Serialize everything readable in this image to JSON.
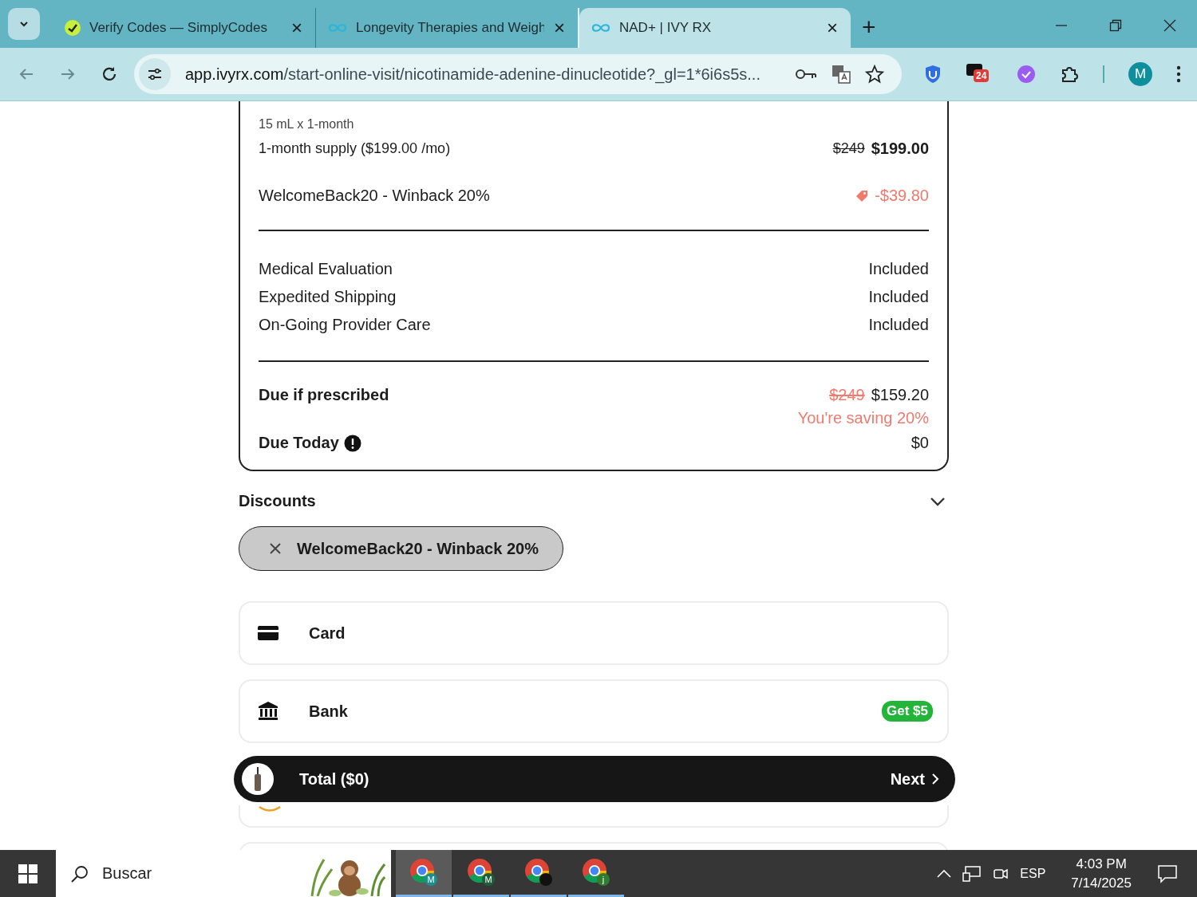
{
  "browser": {
    "tabs": [
      {
        "title": "Verify Codes — SimplyCodes",
        "close": "×",
        "selected": false,
        "kind": "simplycodes"
      },
      {
        "title": "Longevity Therapies and Weigh",
        "close": "×",
        "selected": false,
        "kind": "ivy"
      },
      {
        "title": "NAD+ | IVY RX",
        "close": "×",
        "selected": true,
        "kind": "ivy"
      }
    ],
    "new_tab": "+",
    "url_host": "app.ivyrx.com",
    "url_path": "/start-online-visit/nicotinamide-adenine-dinucleotide?_gl=1*6i6s5s...",
    "notification_badge": "24",
    "profile": "M"
  },
  "order": {
    "variant": "15 mL x 1-month",
    "supply": {
      "label": "1-month supply ($199.00 /mo)",
      "old_price": "$249",
      "price": "$199.00"
    },
    "coupon": {
      "label": "WelcomeBack20 - Winback 20%",
      "amount": "-$39.80"
    },
    "included": [
      {
        "label": "Medical Evaluation",
        "value": "Included"
      },
      {
        "label": "Expedited Shipping",
        "value": "Included"
      },
      {
        "label": "On-Going Provider Care",
        "value": "Included"
      }
    ],
    "due_if_prescribed": {
      "label": "Due if prescribed",
      "old_price": "$249",
      "price": "$159.20",
      "saving": "You're saving 20%"
    },
    "due_today": {
      "label": "Due Today",
      "value": "$0"
    }
  },
  "discounts": {
    "title": "Discounts",
    "expanded": true,
    "applied": [
      {
        "label": "WelcomeBack20 - Winback 20%"
      }
    ]
  },
  "payment_methods": [
    {
      "kind": "card",
      "label": "Card"
    },
    {
      "kind": "bank",
      "label": "Bank",
      "badge": "Get $5"
    },
    {
      "kind": "amazon"
    },
    {
      "kind": "other"
    }
  ],
  "total_bar": {
    "label": "Total ($0)",
    "next": "Next"
  },
  "taskbar": {
    "search": "Buscar",
    "apps": [
      {
        "letter": "M",
        "color": "#1a8f8f",
        "selected": true
      },
      {
        "letter": "M",
        "color": "#1e5e3a",
        "selected": false
      },
      {
        "color": "#111111",
        "selected": false
      },
      {
        "letter": "j",
        "color": "#2e7d32",
        "selected": false
      }
    ],
    "language": "ESP",
    "time": "4:03 PM",
    "date": "7/14/2025"
  }
}
